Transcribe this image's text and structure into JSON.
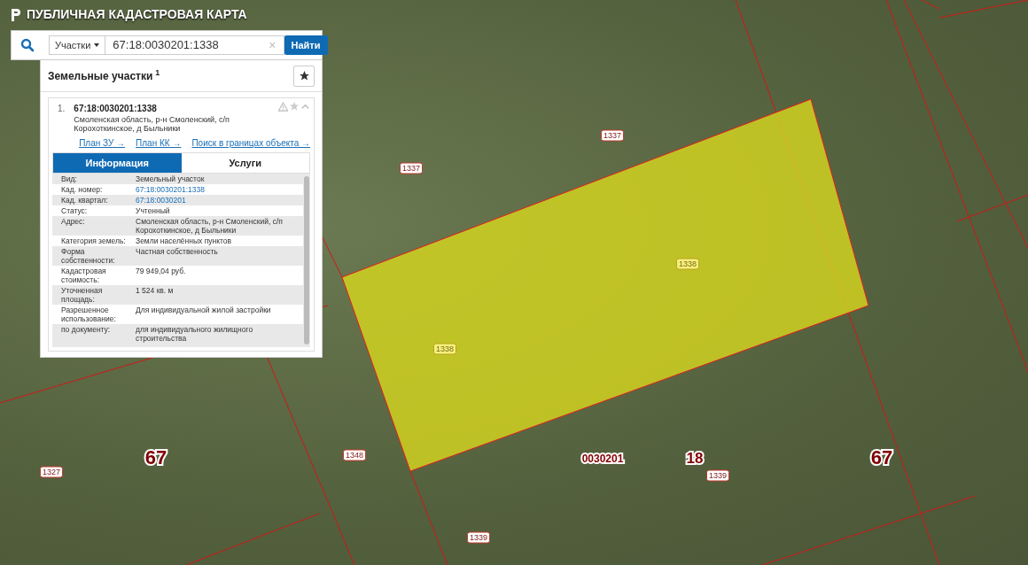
{
  "header": {
    "title": "ПУБЛИЧНАЯ КАДАСТРОВАЯ КАРТА"
  },
  "search": {
    "category": "Участки",
    "value": "67:18:0030201:1338",
    "clear": "×",
    "button": "Найти"
  },
  "results": {
    "title": "Земельные участки",
    "count": "1",
    "items": [
      {
        "index": "1.",
        "number": "67:18:0030201:1338",
        "address": "Смоленская область, р-н Смоленский, с/п Корохоткинское, д Быльники",
        "links": [
          "План ЗУ →",
          "План КК →",
          "Поиск в границах объекта →"
        ],
        "tabs": [
          {
            "label": "Информация",
            "selected": true
          },
          {
            "label": "Услуги",
            "selected": false
          }
        ],
        "attributes": [
          {
            "label": "Вид:",
            "value": "Земельный участок",
            "kind": "text"
          },
          {
            "label": "Кад. номер:",
            "value": "67:18:0030201:1338",
            "kind": "link"
          },
          {
            "label": "Кад. квартал:",
            "value": "67:18:0030201",
            "kind": "link"
          },
          {
            "label": "Статус:",
            "value": "Учтенный",
            "kind": "text"
          },
          {
            "label": "Адрес:",
            "value": "Смоленская область, р-н Смоленский, с/п Корохоткинское, д Быльники",
            "kind": "text"
          },
          {
            "label": "Категория земель:",
            "value": "Земли населённых пунктов",
            "kind": "text"
          },
          {
            "label": "Форма собственности:",
            "value": "Частная собственность",
            "kind": "text"
          },
          {
            "label": "Кадастровая стоимость:",
            "value": "79 949,04 руб.",
            "kind": "text"
          },
          {
            "label": "Уточненная площадь:",
            "value": "1 524 кв. м",
            "kind": "text"
          },
          {
            "label": "Разрешенное использование:",
            "value": "Для индивидуальной жилой застройки",
            "kind": "text"
          },
          {
            "label": "по документу:",
            "value": "для индивидуального жилищного строительства",
            "kind": "text"
          }
        ]
      }
    ]
  },
  "map": {
    "labels": [
      {
        "text": "1337",
        "kind": "parcel"
      },
      {
        "text": "1337",
        "kind": "parcel"
      },
      {
        "text": "1338",
        "kind": "selected"
      },
      {
        "text": "1338",
        "kind": "selected"
      },
      {
        "text": "67",
        "kind": "region"
      },
      {
        "text": "1348",
        "kind": "parcel"
      },
      {
        "text": "0030201",
        "kind": "quarter"
      },
      {
        "text": "18",
        "kind": "district"
      },
      {
        "text": "67",
        "kind": "region"
      },
      {
        "text": "1339",
        "kind": "parcel"
      },
      {
        "text": "1327",
        "kind": "parcel"
      },
      {
        "text": "1339",
        "kind": "parcel"
      }
    ]
  }
}
